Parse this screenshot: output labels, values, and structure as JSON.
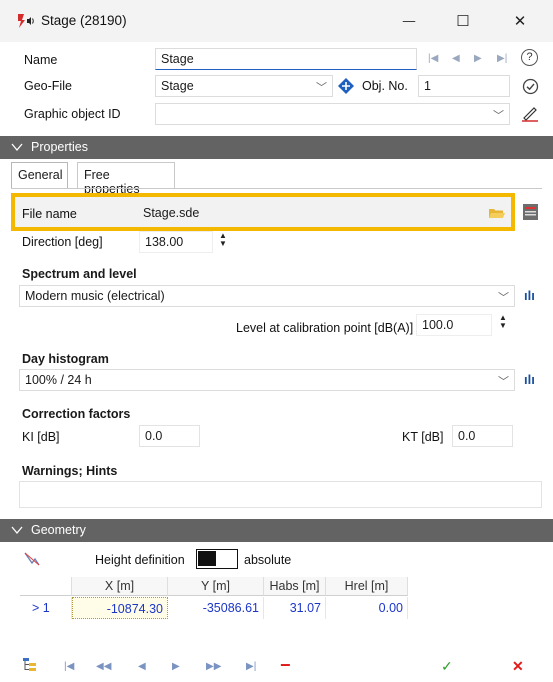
{
  "window": {
    "title": "Stage (28190)",
    "controls": {
      "minimize": "—",
      "maximize": "☐",
      "close": "✕"
    }
  },
  "header_form": {
    "name_label": "Name",
    "name_value": "Stage",
    "geofile_label": "Geo-File",
    "geofile_value": "Stage",
    "objno_label": "Obj. No.",
    "objno_value": "1",
    "graphic_id_label": "Graphic object ID",
    "graphic_id_value": "",
    "nav_icons": [
      "first-record-icon",
      "previous-record-icon",
      "next-record-icon",
      "last-record-icon"
    ],
    "help_icon": "?"
  },
  "properties_section": {
    "title": "Properties",
    "tabs": [
      {
        "label": "General",
        "active": true
      },
      {
        "label": "Free properties",
        "active": false
      }
    ],
    "file_name_label": "File name",
    "file_name_value": "Stage.sde",
    "direction_label": "Direction [deg]",
    "direction_value": "138.00",
    "spectrum_heading": "Spectrum and level",
    "spectrum_value": "Modern music (electrical)",
    "level_label": "Level at calibration point [dB(A)]",
    "level_value": "100.0",
    "day_histogram_heading": "Day histogram",
    "day_histogram_value": "100% / 24 h",
    "correction_heading": "Correction factors",
    "ki_label": "KI [dB]",
    "ki_value": "0.0",
    "kt_label": "KT [dB]",
    "kt_value": "0.0",
    "warnings_heading": "Warnings; Hints",
    "warnings_value": ""
  },
  "geometry_section": {
    "title": "Geometry",
    "height_definition_label": "Height definition",
    "height_definition_value": "absolute",
    "columns": [
      "",
      "X [m]",
      "Y [m]",
      "Habs [m]",
      "Hrel [m]"
    ],
    "rows": [
      {
        "index": "> 1",
        "x": "-10874.30",
        "y": "-35086.61",
        "habs": "31.07",
        "hrel": "0.00"
      }
    ]
  },
  "toolbar": {
    "buttons": [
      "tree-icon",
      "first-icon",
      "fast-back-icon",
      "back-icon",
      "forward-icon",
      "fast-forward-icon",
      "last-icon",
      "delete-icon",
      "ok-icon",
      "cancel-icon"
    ],
    "delete_glyph": "−",
    "ok_glyph": "✓",
    "cancel_glyph": "✕"
  },
  "colors": {
    "accent_blue": "#1f5fbf",
    "highlight": "#f5b800",
    "section_bar": "#636363",
    "data_blue": "#1c36c8",
    "delete_red": "#e01b1b",
    "ok_green": "#2f9e2f"
  }
}
